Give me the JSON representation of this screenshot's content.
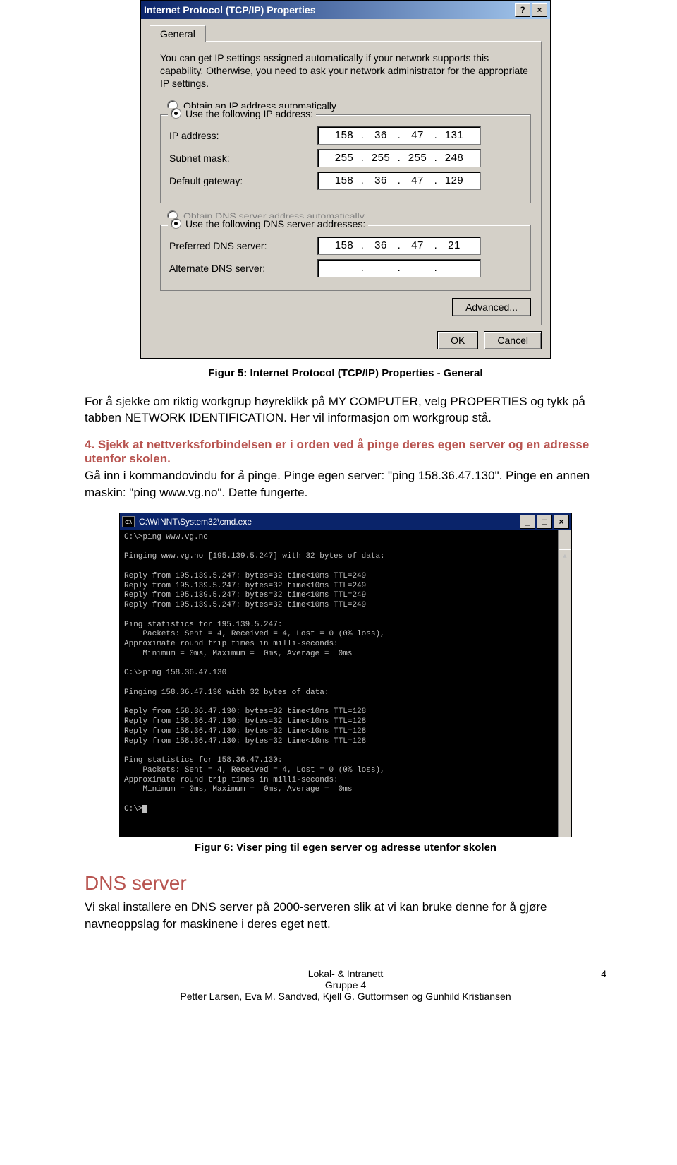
{
  "dialog": {
    "title": "Internet Protocol (TCP/IP) Properties",
    "help_btn": "?",
    "close_btn": "×",
    "tab": "General",
    "desc": "You can get IP settings assigned automatically if your network supports this capability. Otherwise, you need to ask your network administrator for the appropriate IP settings.",
    "radio_auto_ip": "Obtain an IP address automatically",
    "radio_use_ip": "Use the following IP address:",
    "ip_label": "IP address:",
    "ip_value": [
      "158",
      "36",
      "47",
      "131"
    ],
    "subnet_label": "Subnet mask:",
    "subnet_value": [
      "255",
      "255",
      "255",
      "248"
    ],
    "gateway_label": "Default gateway:",
    "gateway_value": [
      "158",
      "36",
      "47",
      "129"
    ],
    "radio_auto_dns": "Obtain DNS server address automatically",
    "radio_use_dns": "Use the following DNS server addresses:",
    "pref_dns_label": "Preferred DNS server:",
    "pref_dns_value": [
      "158",
      "36",
      "47",
      "21"
    ],
    "alt_dns_label": "Alternate DNS server:",
    "alt_dns_value": [
      "",
      "",
      "",
      ""
    ],
    "advanced_btn": "Advanced...",
    "ok_btn": "OK",
    "cancel_btn": "Cancel"
  },
  "fig5_cap": "Figur 5: Internet Protocol (TCP/IP) Properties - General",
  "para1": "For å sjekke om riktig workgrup høyreklikk på MY COMPUTER, velg PROPERTIES og tykk på tabben NETWORK IDENTIFICATION. Her vil informasjon om workgroup stå.",
  "step4_heading": "4. Sjekk at nettverksforbindelsen er i orden ved å pinge deres egen server og en adresse utenfor skolen.",
  "para2": "Gå inn i kommandovindu for å pinge. Pinge egen server: \"ping 158.36.47.130\". Pinge en annen maskin: \"ping www.vg.no\". Dette fungerte.",
  "cmd": {
    "title": "C:\\WINNT\\System32\\cmd.exe",
    "lines": "C:\\>ping www.vg.no\n\nPinging www.vg.no [195.139.5.247] with 32 bytes of data:\n\nReply from 195.139.5.247: bytes=32 time<10ms TTL=249\nReply from 195.139.5.247: bytes=32 time<10ms TTL=249\nReply from 195.139.5.247: bytes=32 time<10ms TTL=249\nReply from 195.139.5.247: bytes=32 time<10ms TTL=249\n\nPing statistics for 195.139.5.247:\n    Packets: Sent = 4, Received = 4, Lost = 0 (0% loss),\nApproximate round trip times in milli-seconds:\n    Minimum = 0ms, Maximum =  0ms, Average =  0ms\n\nC:\\>ping 158.36.47.130\n\nPinging 158.36.47.130 with 32 bytes of data:\n\nReply from 158.36.47.130: bytes=32 time<10ms TTL=128\nReply from 158.36.47.130: bytes=32 time<10ms TTL=128\nReply from 158.36.47.130: bytes=32 time<10ms TTL=128\nReply from 158.36.47.130: bytes=32 time<10ms TTL=128\n\nPing statistics for 158.36.47.130:\n    Packets: Sent = 4, Received = 4, Lost = 0 (0% loss),\nApproximate round trip times in milli-seconds:\n    Minimum = 0ms, Maximum =  0ms, Average =  0ms\n\nC:\\>"
  },
  "fig6_cap": "Figur 6: Viser ping til egen server og adresse utenfor skolen",
  "section_heading": "DNS server",
  "para3": "Vi skal installere en DNS server på 2000-serveren slik at vi kan bruke denne for å gjøre navneoppslag for maskinene i deres eget nett.",
  "footer": {
    "line1": "Lokal- & Intranett",
    "line2": "Gruppe 4",
    "line3": "Petter Larsen, Eva M. Sandved, Kjell G. Guttormsen og Gunhild Kristiansen",
    "pagenum": "4"
  }
}
